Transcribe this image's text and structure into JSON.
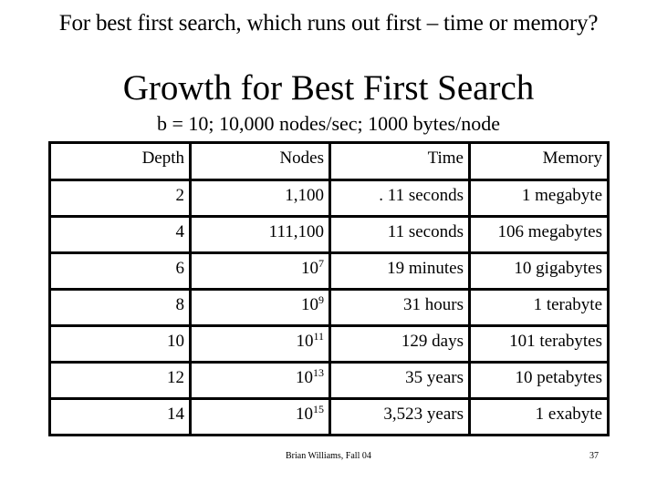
{
  "slide": {
    "question": "For best first search, which runs out first – time or memory?",
    "title": "Growth for Best First Search",
    "subtitle": "b = 10; 10,000 nodes/sec; 1000 bytes/node",
    "footer": "Brian Williams, Fall 04",
    "page_number": "37"
  },
  "table": {
    "headers": [
      "Depth",
      "Nodes",
      "Time",
      "Memory"
    ],
    "rows": [
      {
        "depth": "2",
        "nodes_base": "1,100",
        "nodes_exp": "",
        "time": ". 11 seconds",
        "memory": "1 megabyte"
      },
      {
        "depth": "4",
        "nodes_base": "111,100",
        "nodes_exp": "",
        "time": "11 seconds",
        "memory": "106 megabytes"
      },
      {
        "depth": "6",
        "nodes_base": "10",
        "nodes_exp": "7",
        "time": "19 minutes",
        "memory": "10 gigabytes"
      },
      {
        "depth": "8",
        "nodes_base": "10",
        "nodes_exp": "9",
        "time": "31 hours",
        "memory": "1 terabyte"
      },
      {
        "depth": "10",
        "nodes_base": "10",
        "nodes_exp": "11",
        "time": "129 days",
        "memory": "101 terabytes"
      },
      {
        "depth": "12",
        "nodes_base": "10",
        "nodes_exp": "13",
        "time": "35 years",
        "memory": "10 petabytes"
      },
      {
        "depth": "14",
        "nodes_base": "10",
        "nodes_exp": "15",
        "time": "3,523 years",
        "memory": "1 exabyte"
      }
    ]
  }
}
